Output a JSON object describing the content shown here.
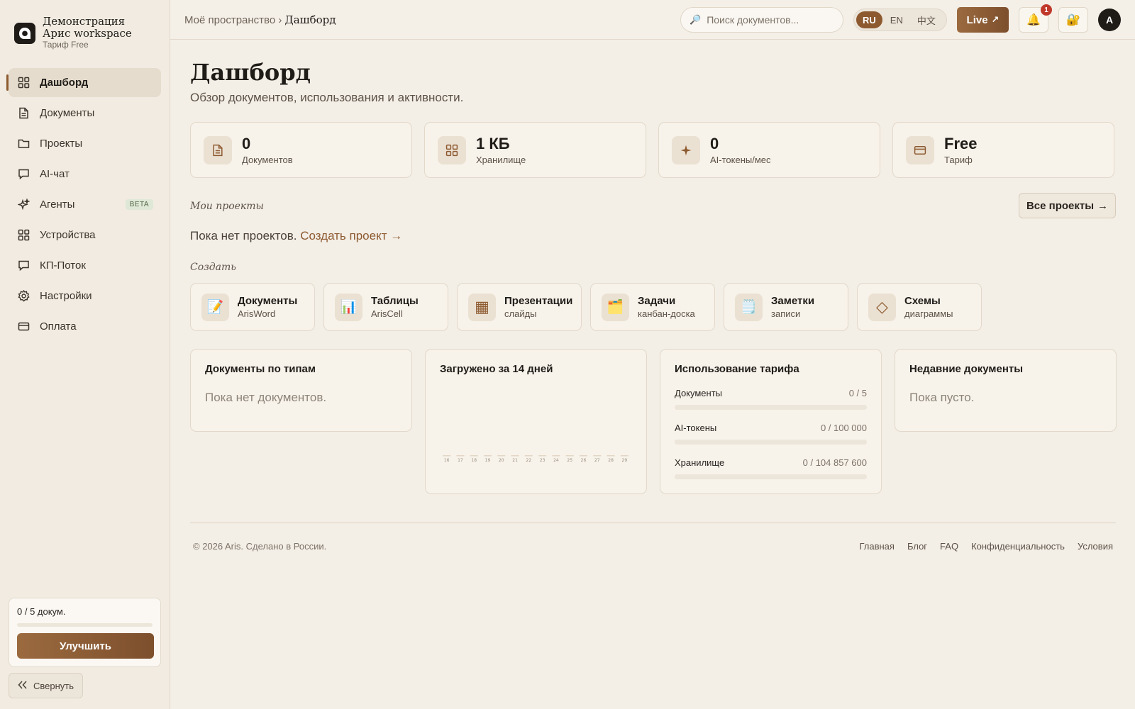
{
  "brand": {
    "name": "Демонстрация Арис workspace",
    "plan": "Тариф Free"
  },
  "sidebar": {
    "items": [
      {
        "label": "Дашборд",
        "icon": "grid-icon",
        "active": true
      },
      {
        "label": "Документы",
        "icon": "document-icon"
      },
      {
        "label": "Проекты",
        "icon": "folder-icon"
      },
      {
        "label": "AI-чат",
        "icon": "chat-icon"
      },
      {
        "label": "Агенты",
        "icon": "sparkle-icon",
        "badge": "BETA"
      },
      {
        "label": "Устройства",
        "icon": "grid-icon"
      },
      {
        "label": "КП-Поток",
        "icon": "chat-icon"
      },
      {
        "label": "Настройки",
        "icon": "gear-icon"
      },
      {
        "label": "Оплата",
        "icon": "card-icon"
      }
    ],
    "usage": {
      "label": "0 / 5 докум.",
      "fraction": 0
    },
    "upgrade_label": "Улучшить",
    "collapse_label": "Свернуть"
  },
  "header": {
    "breadcrumb_root": "Моё пространство",
    "breadcrumb_sep": "›",
    "breadcrumb_current": "Дашборд",
    "search_placeholder": "Поиск документов...",
    "languages": [
      "RU",
      "EN",
      "中文"
    ],
    "active_language": "RU",
    "live_label": "Live",
    "notifications_count": "1",
    "avatar_initial": "A"
  },
  "page": {
    "title": "Дашборд",
    "subtitle": "Обзор документов, использования и активности."
  },
  "stats": [
    {
      "value": "0",
      "label": "Документов",
      "icon": "document-icon"
    },
    {
      "value": "1 КБ",
      "label": "Хранилище",
      "icon": "grid-icon"
    },
    {
      "value": "0",
      "label": "AI-токены/мес",
      "icon": "sparkle-icon"
    },
    {
      "value": "Free",
      "label": "Тариф",
      "icon": "card-icon"
    }
  ],
  "projects": {
    "section_label": "Мои проекты",
    "all_label": "Все проекты",
    "empty_text": "Пока нет проектов.",
    "create_link": "Создать проект →"
  },
  "create": {
    "section_label": "Создать",
    "items": [
      {
        "title": "Документы",
        "sub": "ArisWord",
        "icon": "📝"
      },
      {
        "title": "Таблицы",
        "sub": "ArisCell",
        "icon": "📊"
      },
      {
        "title": "Презентации",
        "sub": "слайды",
        "icon": "▦"
      },
      {
        "title": "Задачи",
        "sub": "канбан-доска",
        "icon": "🗂️"
      },
      {
        "title": "Заметки",
        "sub": "записи",
        "icon": "🗒️"
      },
      {
        "title": "Схемы",
        "sub": "диаграммы",
        "icon": "◇"
      }
    ]
  },
  "panels": {
    "types": {
      "title": "Документы по типам",
      "empty": "Пока нет документов."
    },
    "uploads": {
      "title": "Загружено за 14 дней"
    },
    "usage": {
      "title": "Использование тарифа",
      "rows": [
        {
          "label": "Документы",
          "value": "0 / 5",
          "fraction": 0
        },
        {
          "label": "AI-токены",
          "value": "0 / 100 000",
          "fraction": 0
        },
        {
          "label": "Хранилище",
          "value": "0 / 104 857 600",
          "fraction": 0
        }
      ]
    },
    "recent": {
      "title": "Недавние документы",
      "empty": "Пока пусто."
    }
  },
  "chart_data": {
    "type": "bar",
    "categories": [
      "16",
      "17",
      "18",
      "19",
      "20",
      "21",
      "22",
      "23",
      "24",
      "25",
      "26",
      "27",
      "28",
      "29"
    ],
    "values": [
      0,
      0,
      0,
      0,
      0,
      0,
      0,
      0,
      0,
      0,
      0,
      0,
      0,
      0
    ],
    "title": "Загружено за 14 дней",
    "xlabel": "",
    "ylabel": ""
  },
  "footer": {
    "copyright": "© 2026 Aris. Сделано в России.",
    "links": [
      "Главная",
      "Блог",
      "FAQ",
      "Конфиденциальность",
      "Условия"
    ]
  },
  "colors": {
    "accent": "#8d5a30",
    "background": "#f3eee6",
    "badge": "#c0392b"
  }
}
